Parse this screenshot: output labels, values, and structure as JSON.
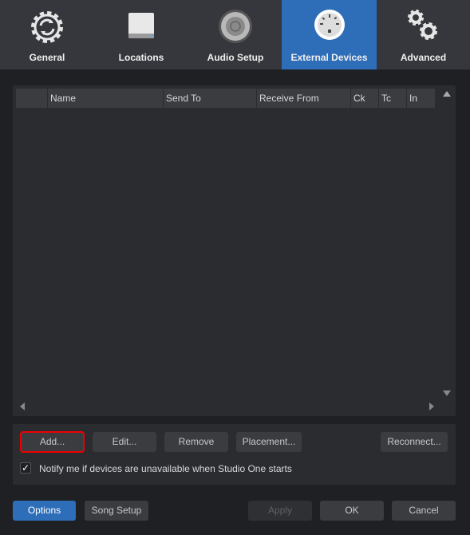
{
  "tabs": [
    {
      "label": "General",
      "icon": "gear-sync-icon"
    },
    {
      "label": "Locations",
      "icon": "drive-icon"
    },
    {
      "label": "Audio Setup",
      "icon": "speaker-icon"
    },
    {
      "label": "External Devices",
      "icon": "midi-connector-icon",
      "active": true
    },
    {
      "label": "Advanced",
      "icon": "gears-icon"
    }
  ],
  "table": {
    "columns": [
      "",
      "Name",
      "Send To",
      "Receive From",
      "Ck",
      "Tc",
      "In"
    ],
    "rows": []
  },
  "actions": {
    "add": "Add...",
    "edit": "Edit...",
    "remove": "Remove",
    "placement": "Placement...",
    "reconnect": "Reconnect..."
  },
  "notify": {
    "label": "Notify me if devices are unavailable when Studio One starts",
    "checked": true
  },
  "footer": {
    "options": "Options",
    "song_setup": "Song Setup",
    "apply": "Apply",
    "ok": "OK",
    "cancel": "Cancel"
  },
  "colors": {
    "accent": "#2e6db8",
    "highlight": "#e00000"
  }
}
